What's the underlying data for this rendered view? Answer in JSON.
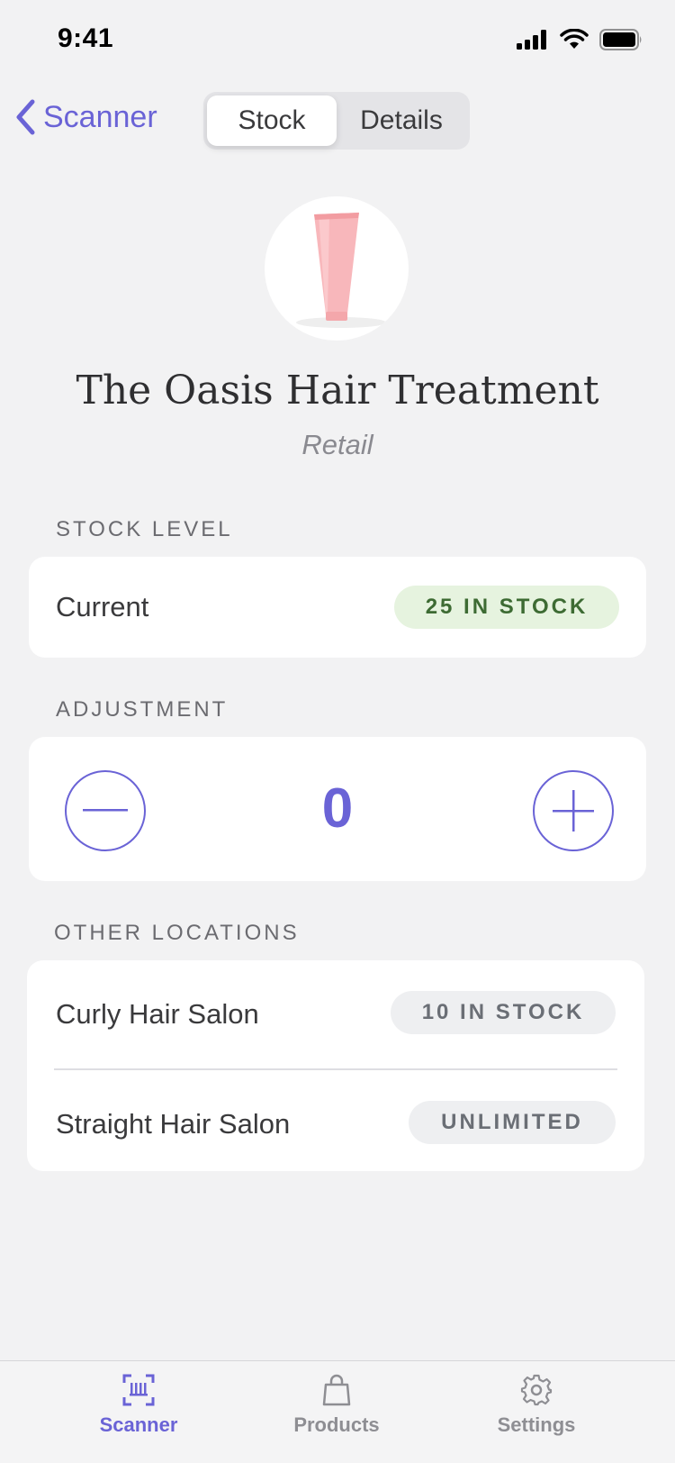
{
  "status_bar": {
    "time": "9:41"
  },
  "nav": {
    "back_label": "Scanner",
    "segments": [
      {
        "label": "Stock",
        "active": true
      },
      {
        "label": "Details",
        "active": false
      }
    ]
  },
  "product": {
    "title": "The Oasis Hair Treatment",
    "subtitle": "Retail"
  },
  "stock_level": {
    "section_label": "STOCK LEVEL",
    "current_label": "Current",
    "current_badge": "25 IN STOCK"
  },
  "adjustment": {
    "section_label": "ADJUSTMENT",
    "value": "0"
  },
  "other_locations": {
    "section_label": "OTHER LOCATIONS",
    "items": [
      {
        "name": "Curly Hair Salon",
        "badge": "10 IN STOCK"
      },
      {
        "name": "Straight Hair Salon",
        "badge": "UNLIMITED"
      }
    ]
  },
  "tab_bar": {
    "tabs": [
      {
        "label": "Scanner",
        "icon": "barcode-scan-icon",
        "active": true
      },
      {
        "label": "Products",
        "icon": "shopping-bag-icon",
        "active": false
      },
      {
        "label": "Settings",
        "icon": "gear-icon",
        "active": false
      }
    ]
  },
  "colors": {
    "accent": "#6a63d6",
    "background": "#f2f2f3",
    "badge_green_bg": "#e6f3df",
    "badge_green_text": "#3d6b33",
    "badge_gray_bg": "#eeeff1"
  }
}
